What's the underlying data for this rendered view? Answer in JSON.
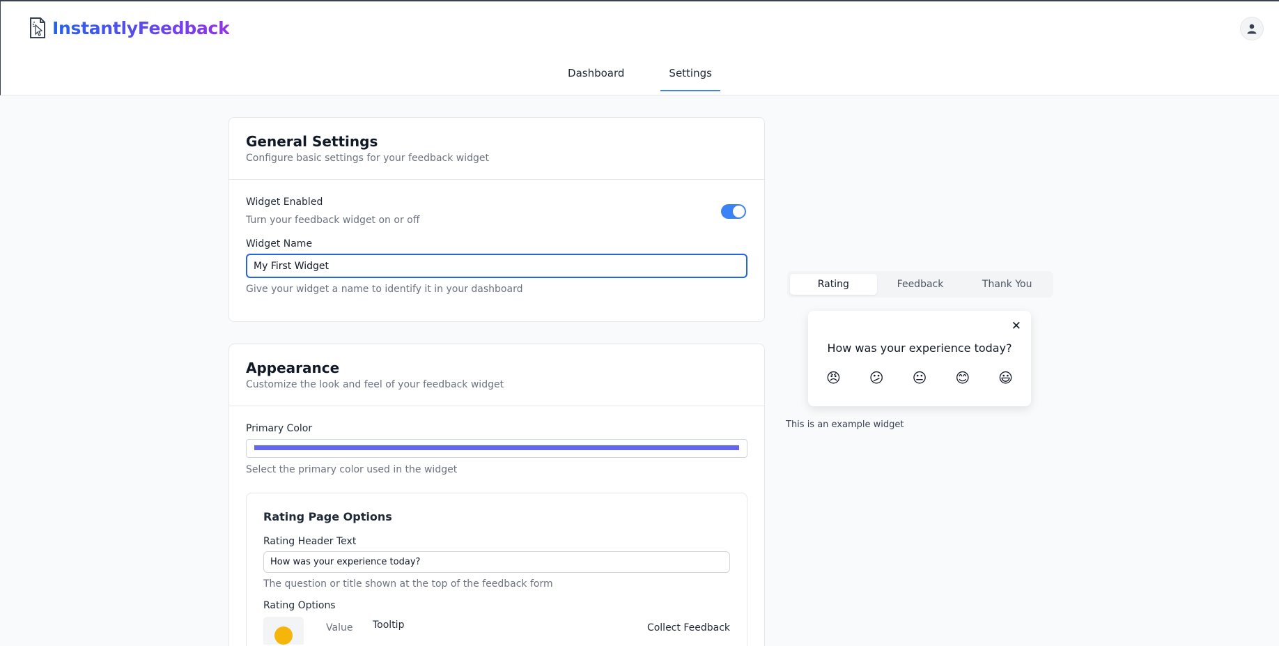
{
  "brand": {
    "name": "InstantlyFeedback",
    "gradient_from": "#2563eb",
    "gradient_to": "#9333ea"
  },
  "header": {
    "user_icon": "user-icon"
  },
  "nav": {
    "tabs": [
      {
        "label": "Dashboard",
        "active": false
      },
      {
        "label": "Settings",
        "active": true
      }
    ]
  },
  "general": {
    "title": "General Settings",
    "description": "Configure basic settings for your feedback widget",
    "enabled_label": "Widget Enabled",
    "enabled_help": "Turn your feedback widget on or off",
    "enabled": true,
    "name_label": "Widget Name",
    "name_value": "My First Widget",
    "name_help": "Give your widget a name to identify it in your dashboard"
  },
  "appearance": {
    "title": "Appearance",
    "description": "Customize the look and feel of your feedback widget",
    "primary_color_label": "Primary Color",
    "primary_color": "#6366f1",
    "primary_color_help": "Select the primary color used in the widget",
    "rating_page": {
      "title": "Rating Page Options",
      "header_text_label": "Rating Header Text",
      "header_text_value": "How was your experience today?",
      "header_text_help": "The question or title shown at the top of the feedback form",
      "options_label": "Rating Options",
      "col_value": "Value",
      "col_tooltip": "Tooltip",
      "col_collect": "Collect Feedback"
    }
  },
  "preview": {
    "tabs": [
      {
        "label": "Rating",
        "active": true
      },
      {
        "label": "Feedback",
        "active": false
      },
      {
        "label": "Thank You",
        "active": false
      }
    ],
    "question": "How was your experience today?",
    "close_glyph": "✕",
    "emojis": [
      "😠",
      "😕",
      "😐",
      "😊",
      "😃"
    ],
    "note": "This is an example widget"
  },
  "colors": {
    "accent": "#3b82f6",
    "primary": "#6366f1"
  }
}
